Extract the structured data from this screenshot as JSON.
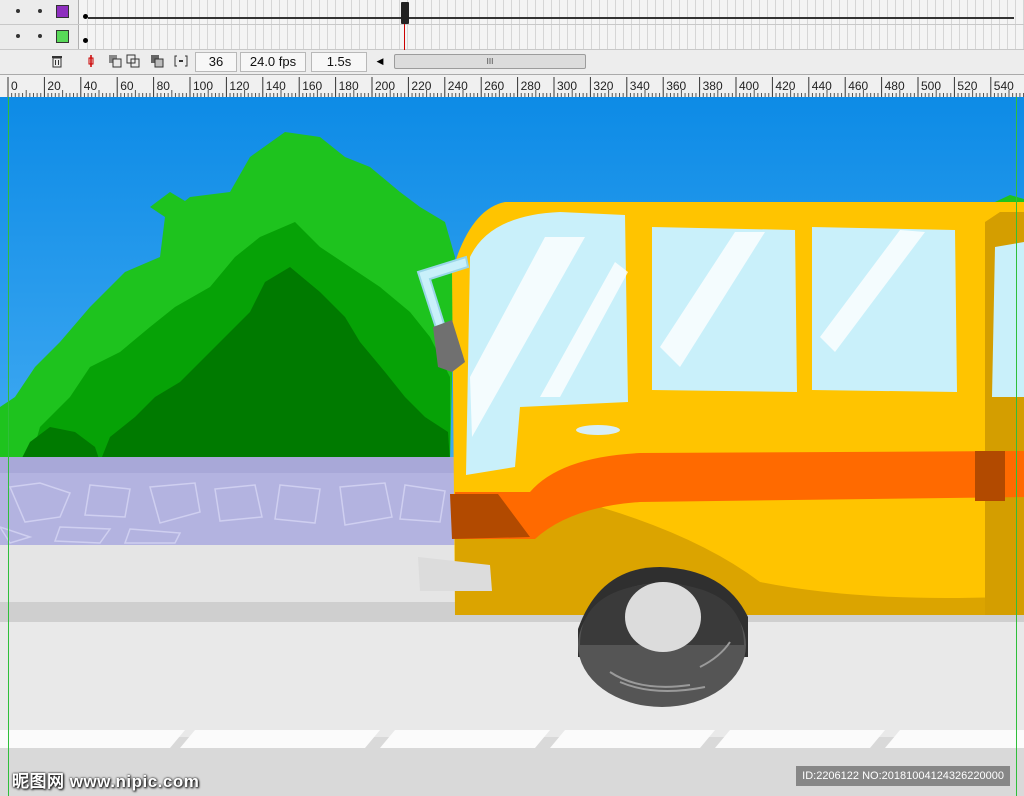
{
  "timeline": {
    "layers": [
      {
        "color": "#8e2fbf"
      },
      {
        "color": "#58d858"
      }
    ],
    "current_frame": "36",
    "frame_rate": "24.0 fps",
    "elapsed_time": "1.5s",
    "scrollbar_grip": "III"
  },
  "ruler": {
    "ticks": [
      "0",
      "20",
      "40",
      "60",
      "80",
      "100",
      "120",
      "140",
      "160",
      "180",
      "200",
      "220",
      "240",
      "260",
      "280",
      "300",
      "320",
      "340",
      "360",
      "380",
      "400",
      "420",
      "440",
      "460",
      "480",
      "500",
      "520",
      "540"
    ]
  },
  "watermark": {
    "site": "昵图网 www.nipic.com",
    "id_text": "ID:2206122 NO:20181004124326220000"
  },
  "colors": {
    "sky": "#1a8fe8",
    "bus_body": "#ffc400",
    "bus_stripe": "#ff6a00",
    "window_glass": "#c9f0fa",
    "bush_light": "#1ec31e",
    "bush_dark": "#007a00",
    "wall": "#b0b0dc",
    "road": "#e3e3e3"
  }
}
